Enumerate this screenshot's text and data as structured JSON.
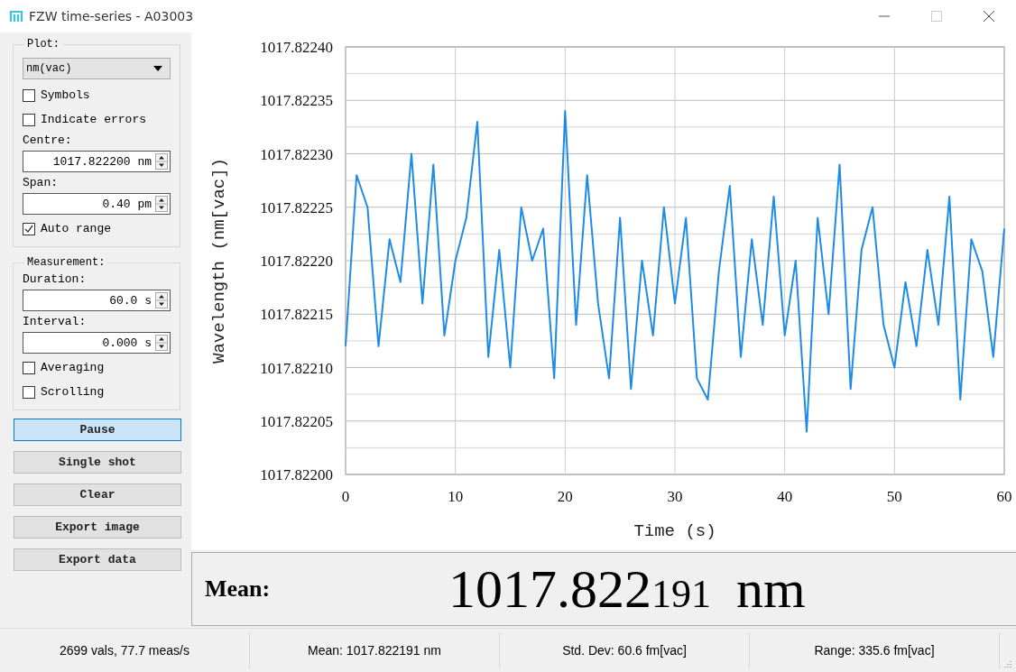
{
  "window": {
    "title": "FZW time-series - A03003"
  },
  "groups": [
    {
      "title": "Plot:",
      "items": [
        {
          "kind": "dropdown",
          "value": "nm(vac)"
        },
        {
          "kind": "checkbox",
          "label": "Symbols",
          "checked": false
        },
        {
          "kind": "checkbox",
          "label": "Indicate errors",
          "checked": false
        },
        {
          "kind": "label",
          "label": "Centre:"
        },
        {
          "kind": "spinbox",
          "value": "1017.822200 nm"
        },
        {
          "kind": "label",
          "label": "Span:"
        },
        {
          "kind": "spinbox",
          "value": "0.40 pm"
        },
        {
          "kind": "checkbox",
          "label": "Auto range",
          "checked": true
        }
      ]
    },
    {
      "title": "Measurement:",
      "items": [
        {
          "kind": "label",
          "label": "Duration:"
        },
        {
          "kind": "spinbox",
          "value": "60.0 s"
        },
        {
          "kind": "label",
          "label": "Interval:"
        },
        {
          "kind": "spinbox",
          "value": "0.000 s"
        },
        {
          "kind": "checkbox",
          "label": "Averaging",
          "checked": false
        },
        {
          "kind": "checkbox",
          "label": "Scrolling",
          "checked": false
        }
      ]
    }
  ],
  "buttons": [
    {
      "label": "Pause",
      "focused": true
    },
    {
      "label": "Single shot",
      "focused": false
    },
    {
      "label": "Clear",
      "focused": false
    },
    {
      "label": "Export image",
      "focused": false
    },
    {
      "label": "Export data",
      "focused": false
    }
  ],
  "chart_data": {
    "type": "line",
    "xlabel": "Time (s)",
    "ylabel": "Wavelength (nm[vac])",
    "x": [
      0,
      1,
      2,
      3,
      4,
      5,
      6,
      7,
      8,
      9,
      10,
      11,
      12,
      13,
      14,
      15,
      16,
      17,
      18,
      19,
      20,
      21,
      22,
      23,
      24,
      25,
      26,
      27,
      28,
      29,
      30,
      31,
      32,
      33,
      34,
      35,
      36,
      37,
      38,
      39,
      40,
      41,
      42,
      43,
      44,
      45,
      46,
      47,
      48,
      49,
      50,
      51,
      52,
      53,
      54,
      55,
      56,
      57,
      58,
      59,
      60
    ],
    "series": [
      {
        "color": "#1e8ce6",
        "values": [
          1017.82212,
          1017.82228,
          1017.82225,
          1017.82212,
          1017.82222,
          1017.82218,
          1017.8223,
          1017.82216,
          1017.82229,
          1017.82213,
          1017.8222,
          1017.82224,
          1017.82233,
          1017.82211,
          1017.82221,
          1017.8221,
          1017.82225,
          1017.8222,
          1017.82223,
          1017.82209,
          1017.82234,
          1017.82214,
          1017.82228,
          1017.82216,
          1017.82209,
          1017.82224,
          1017.82208,
          1017.8222,
          1017.82213,
          1017.82225,
          1017.82216,
          1017.82224,
          1017.82209,
          1017.82207,
          1017.82219,
          1017.82227,
          1017.82211,
          1017.82222,
          1017.82214,
          1017.82226,
          1017.82213,
          1017.8222,
          1017.82204,
          1017.82224,
          1017.82215,
          1017.82229,
          1017.82208,
          1017.82221,
          1017.82225,
          1017.82214,
          1017.8221,
          1017.82218,
          1017.82212,
          1017.82221,
          1017.82214,
          1017.82226,
          1017.82207,
          1017.82222,
          1017.82219,
          1017.82211,
          1017.82223
        ]
      }
    ],
    "grid": true,
    "xlim": [
      0,
      60
    ],
    "ylim": [
      1017.822,
      1017.8224
    ],
    "xticks": [
      0,
      10,
      20,
      30,
      40,
      50,
      60
    ],
    "yticks": [
      {
        "value": 1017.8224,
        "label": "1017.82240"
      },
      {
        "value": 1017.82235,
        "label": "1017.82235"
      },
      {
        "value": 1017.8223,
        "label": "1017.82230"
      },
      {
        "value": 1017.82225,
        "label": "1017.82225"
      },
      {
        "value": 1017.8222,
        "label": "1017.82220"
      },
      {
        "value": 1017.82215,
        "label": "1017.82215"
      },
      {
        "value": 1017.8221,
        "label": "1017.82210"
      },
      {
        "value": 1017.82205,
        "label": "1017.82205"
      },
      {
        "value": 1017.822,
        "label": "1017.82200"
      }
    ]
  },
  "mean_display": {
    "label": "Mean:",
    "value_major": "1017.822",
    "value_minor": "191",
    "unit": "nm"
  },
  "status_bar": [
    "2699 vals, 77.7 meas/s",
    "Mean: 1017.822191 nm",
    "Std. Dev: 60.6 fm[vac]",
    "Range: 335.6 fm[vac]"
  ]
}
